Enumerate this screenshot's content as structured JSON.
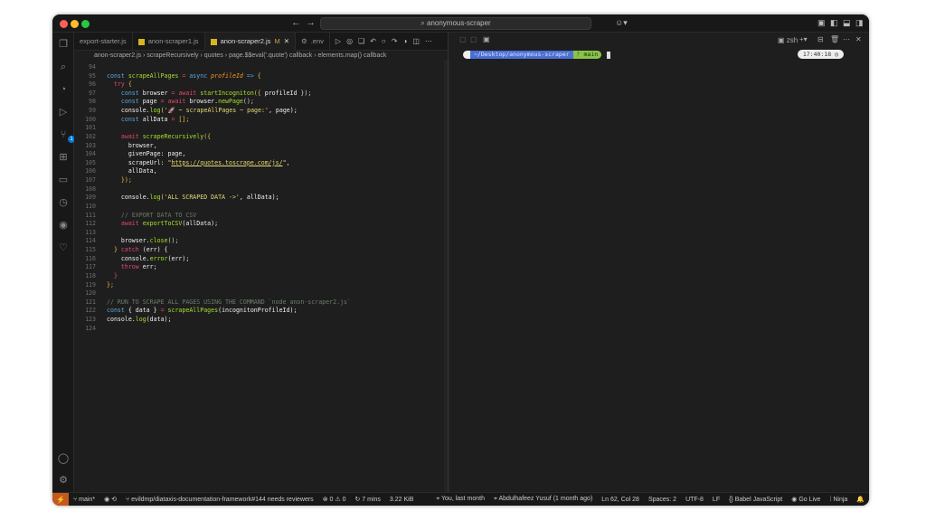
{
  "window": {
    "title": "anonymous-scraper"
  },
  "tabs": [
    {
      "label": "export-starter.js",
      "active": false
    },
    {
      "label": "anon-scraper1.js",
      "active": false
    },
    {
      "label": "anon-scraper2.js",
      "modified": "M",
      "active": true
    },
    {
      "label": ".env",
      "active": false
    }
  ],
  "breadcrumbs": [
    "anon-scraper2.js",
    "scrapeRecursively",
    "quotes",
    "page.$$eval('.quote') callback",
    "elements.map() callback"
  ],
  "code": [
    {
      "n": "94",
      "t": []
    },
    {
      "n": "95",
      "t": [
        [
          "const ",
          "kw"
        ],
        [
          "scrapeAllPages ",
          "fn"
        ],
        [
          "= ",
          "aw"
        ],
        [
          "async ",
          "kw"
        ],
        [
          "profileId ",
          "pr"
        ],
        [
          "=> ",
          "kw"
        ],
        [
          "{",
          "br"
        ]
      ]
    },
    {
      "n": "96",
      "t": [
        [
          "  try ",
          "aw"
        ],
        [
          "{",
          "br"
        ]
      ]
    },
    {
      "n": "97",
      "t": [
        [
          "    const ",
          "kw"
        ],
        [
          "browser ",
          "id"
        ],
        [
          "= ",
          "aw"
        ],
        [
          "await ",
          "aw"
        ],
        [
          "startIncogniton",
          "fn"
        ],
        [
          "({ ",
          "br"
        ],
        [
          "profileId ",
          "id"
        ],
        [
          "});",
          "pn"
        ]
      ]
    },
    {
      "n": "98",
      "t": [
        [
          "    const ",
          "kw"
        ],
        [
          "page ",
          "id"
        ],
        [
          "= ",
          "aw"
        ],
        [
          "await ",
          "aw"
        ],
        [
          "browser.",
          "id"
        ],
        [
          "newPage",
          "fn"
        ],
        [
          "();",
          "pn"
        ]
      ]
    },
    {
      "n": "99",
      "t": [
        [
          "    console.",
          "id"
        ],
        [
          "log",
          "fn"
        ],
        [
          "('🚀 ~ scrapeAllPages ~ page:'",
          "st"
        ],
        [
          ", page);",
          "id"
        ]
      ]
    },
    {
      "n": "100",
      "t": [
        [
          "    const ",
          "kw"
        ],
        [
          "allData ",
          "id"
        ],
        [
          "= ",
          "aw"
        ],
        [
          "[];",
          "br"
        ]
      ]
    },
    {
      "n": "101",
      "t": []
    },
    {
      "n": "102",
      "t": [
        [
          "    await ",
          "aw"
        ],
        [
          "scrapeRecursively",
          "fn"
        ],
        [
          "({",
          "br"
        ]
      ]
    },
    {
      "n": "103",
      "t": [
        [
          "      browser,",
          "id"
        ]
      ]
    },
    {
      "n": "104",
      "t": [
        [
          "      givenPage: page,",
          "id"
        ]
      ]
    },
    {
      "n": "105",
      "t": [
        [
          "      scrapeUrl: ",
          "id"
        ],
        [
          "\"",
          "st"
        ],
        [
          "https://quotes.toscrape.com/js/",
          "url"
        ],
        [
          "\"",
          "st"
        ],
        [
          ",",
          "id"
        ]
      ]
    },
    {
      "n": "106",
      "t": [
        [
          "      allData,",
          "id"
        ]
      ]
    },
    {
      "n": "107",
      "t": [
        [
          "    });",
          "br"
        ]
      ]
    },
    {
      "n": "108",
      "t": []
    },
    {
      "n": "109",
      "t": [
        [
          "    console.",
          "id"
        ],
        [
          "log",
          "fn"
        ],
        [
          "('ALL SCRAPED DATA ->'",
          "st"
        ],
        [
          ", allData);",
          "id"
        ]
      ]
    },
    {
      "n": "110",
      "t": []
    },
    {
      "n": "111",
      "t": [
        [
          "    // EXPORT DATA TO CSV",
          "cm"
        ]
      ]
    },
    {
      "n": "112",
      "t": [
        [
          "    await ",
          "aw"
        ],
        [
          "exportToCSV",
          "fn"
        ],
        [
          "(allData);",
          "id"
        ]
      ]
    },
    {
      "n": "113",
      "t": []
    },
    {
      "n": "114",
      "t": [
        [
          "    browser.",
          "id"
        ],
        [
          "close",
          "fn"
        ],
        [
          "();",
          "pn"
        ]
      ]
    },
    {
      "n": "115",
      "t": [
        [
          "  } ",
          "br"
        ],
        [
          "catch ",
          "aw"
        ],
        [
          "(err) {",
          "id"
        ]
      ]
    },
    {
      "n": "116",
      "t": [
        [
          "    console.",
          "id"
        ],
        [
          "error",
          "fn"
        ],
        [
          "(err);",
          "id"
        ]
      ]
    },
    {
      "n": "117",
      "t": [
        [
          "    throw ",
          "aw"
        ],
        [
          "err;",
          "id"
        ]
      ]
    },
    {
      "n": "118",
      "t": [
        [
          "  }",
          "aw"
        ]
      ]
    },
    {
      "n": "119",
      "t": [
        [
          "};",
          "br"
        ]
      ]
    },
    {
      "n": "120",
      "t": []
    },
    {
      "n": "121",
      "t": [
        [
          "// RUN TO SCRAPE ALL PAGES USING THE COMMAND `node anon-scraper2.js`",
          "cm"
        ]
      ]
    },
    {
      "n": "122",
      "t": [
        [
          "const ",
          "kw"
        ],
        [
          "{ data } ",
          "id"
        ],
        [
          "= ",
          "aw"
        ],
        [
          "scrapeAllPages",
          "fn"
        ],
        [
          "(incognitonProfileId);",
          "id"
        ]
      ]
    },
    {
      "n": "123",
      "t": [
        [
          "console.",
          "id"
        ],
        [
          "log",
          "fn"
        ],
        [
          "(data);",
          "id"
        ]
      ]
    },
    {
      "n": "124",
      "t": []
    }
  ],
  "terminal": {
    "shell": "zsh",
    "os_icon": "",
    "path": "~/Desktop/anonymous-scraper",
    "branch": "main",
    "branch_icon": "ᚠ",
    "time": "17:40:18",
    "check": "✓"
  },
  "status": {
    "branch": "main*",
    "pr": "evildmp/diataxis-documentation-framework#144 needs reviewers",
    "errors": "0",
    "warnings": "0",
    "time": "7 mins",
    "size": "3.22 KiB",
    "blame1": "You, last month",
    "blame2": "Abdulhafeez Yusuf (1 month ago)",
    "position": "Ln 62, Col 28",
    "spaces": "Spaces: 2",
    "encoding": "UTF-8",
    "eol": "LF",
    "language": "Babel JavaScript",
    "golive": "Go Live",
    "ninja": "Ninja"
  },
  "activity_badge": "1"
}
